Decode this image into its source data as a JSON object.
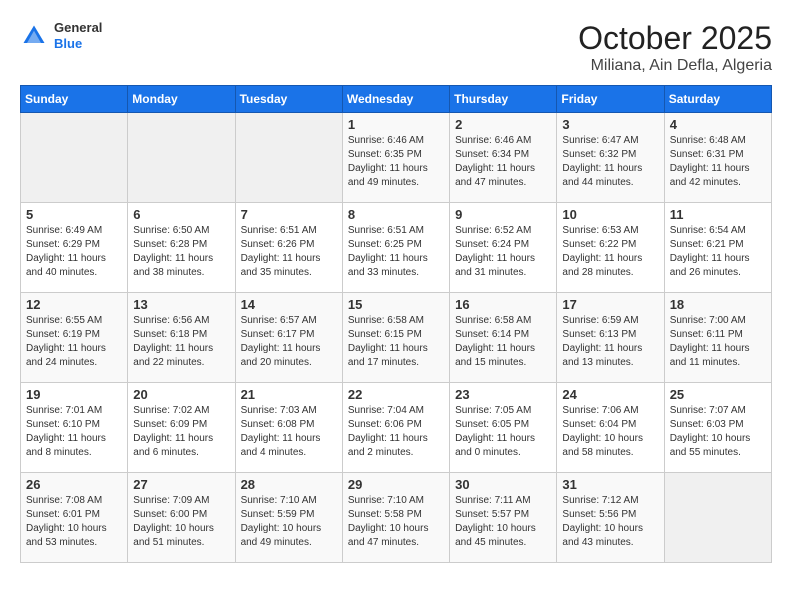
{
  "header": {
    "logo_general": "General",
    "logo_blue": "Blue",
    "title": "October 2025",
    "subtitle": "Miliana, Ain Defla, Algeria"
  },
  "days_of_week": [
    "Sunday",
    "Monday",
    "Tuesday",
    "Wednesday",
    "Thursday",
    "Friday",
    "Saturday"
  ],
  "weeks": [
    [
      {
        "day": "",
        "info": ""
      },
      {
        "day": "",
        "info": ""
      },
      {
        "day": "",
        "info": ""
      },
      {
        "day": "1",
        "info": "Sunrise: 6:46 AM\nSunset: 6:35 PM\nDaylight: 11 hours\nand 49 minutes."
      },
      {
        "day": "2",
        "info": "Sunrise: 6:46 AM\nSunset: 6:34 PM\nDaylight: 11 hours\nand 47 minutes."
      },
      {
        "day": "3",
        "info": "Sunrise: 6:47 AM\nSunset: 6:32 PM\nDaylight: 11 hours\nand 44 minutes."
      },
      {
        "day": "4",
        "info": "Sunrise: 6:48 AM\nSunset: 6:31 PM\nDaylight: 11 hours\nand 42 minutes."
      }
    ],
    [
      {
        "day": "5",
        "info": "Sunrise: 6:49 AM\nSunset: 6:29 PM\nDaylight: 11 hours\nand 40 minutes."
      },
      {
        "day": "6",
        "info": "Sunrise: 6:50 AM\nSunset: 6:28 PM\nDaylight: 11 hours\nand 38 minutes."
      },
      {
        "day": "7",
        "info": "Sunrise: 6:51 AM\nSunset: 6:26 PM\nDaylight: 11 hours\nand 35 minutes."
      },
      {
        "day": "8",
        "info": "Sunrise: 6:51 AM\nSunset: 6:25 PM\nDaylight: 11 hours\nand 33 minutes."
      },
      {
        "day": "9",
        "info": "Sunrise: 6:52 AM\nSunset: 6:24 PM\nDaylight: 11 hours\nand 31 minutes."
      },
      {
        "day": "10",
        "info": "Sunrise: 6:53 AM\nSunset: 6:22 PM\nDaylight: 11 hours\nand 28 minutes."
      },
      {
        "day": "11",
        "info": "Sunrise: 6:54 AM\nSunset: 6:21 PM\nDaylight: 11 hours\nand 26 minutes."
      }
    ],
    [
      {
        "day": "12",
        "info": "Sunrise: 6:55 AM\nSunset: 6:19 PM\nDaylight: 11 hours\nand 24 minutes."
      },
      {
        "day": "13",
        "info": "Sunrise: 6:56 AM\nSunset: 6:18 PM\nDaylight: 11 hours\nand 22 minutes."
      },
      {
        "day": "14",
        "info": "Sunrise: 6:57 AM\nSunset: 6:17 PM\nDaylight: 11 hours\nand 20 minutes."
      },
      {
        "day": "15",
        "info": "Sunrise: 6:58 AM\nSunset: 6:15 PM\nDaylight: 11 hours\nand 17 minutes."
      },
      {
        "day": "16",
        "info": "Sunrise: 6:58 AM\nSunset: 6:14 PM\nDaylight: 11 hours\nand 15 minutes."
      },
      {
        "day": "17",
        "info": "Sunrise: 6:59 AM\nSunset: 6:13 PM\nDaylight: 11 hours\nand 13 minutes."
      },
      {
        "day": "18",
        "info": "Sunrise: 7:00 AM\nSunset: 6:11 PM\nDaylight: 11 hours\nand 11 minutes."
      }
    ],
    [
      {
        "day": "19",
        "info": "Sunrise: 7:01 AM\nSunset: 6:10 PM\nDaylight: 11 hours\nand 8 minutes."
      },
      {
        "day": "20",
        "info": "Sunrise: 7:02 AM\nSunset: 6:09 PM\nDaylight: 11 hours\nand 6 minutes."
      },
      {
        "day": "21",
        "info": "Sunrise: 7:03 AM\nSunset: 6:08 PM\nDaylight: 11 hours\nand 4 minutes."
      },
      {
        "day": "22",
        "info": "Sunrise: 7:04 AM\nSunset: 6:06 PM\nDaylight: 11 hours\nand 2 minutes."
      },
      {
        "day": "23",
        "info": "Sunrise: 7:05 AM\nSunset: 6:05 PM\nDaylight: 11 hours\nand 0 minutes."
      },
      {
        "day": "24",
        "info": "Sunrise: 7:06 AM\nSunset: 6:04 PM\nDaylight: 10 hours\nand 58 minutes."
      },
      {
        "day": "25",
        "info": "Sunrise: 7:07 AM\nSunset: 6:03 PM\nDaylight: 10 hours\nand 55 minutes."
      }
    ],
    [
      {
        "day": "26",
        "info": "Sunrise: 7:08 AM\nSunset: 6:01 PM\nDaylight: 10 hours\nand 53 minutes."
      },
      {
        "day": "27",
        "info": "Sunrise: 7:09 AM\nSunset: 6:00 PM\nDaylight: 10 hours\nand 51 minutes."
      },
      {
        "day": "28",
        "info": "Sunrise: 7:10 AM\nSunset: 5:59 PM\nDaylight: 10 hours\nand 49 minutes."
      },
      {
        "day": "29",
        "info": "Sunrise: 7:10 AM\nSunset: 5:58 PM\nDaylight: 10 hours\nand 47 minutes."
      },
      {
        "day": "30",
        "info": "Sunrise: 7:11 AM\nSunset: 5:57 PM\nDaylight: 10 hours\nand 45 minutes."
      },
      {
        "day": "31",
        "info": "Sunrise: 7:12 AM\nSunset: 5:56 PM\nDaylight: 10 hours\nand 43 minutes."
      },
      {
        "day": "",
        "info": ""
      }
    ]
  ]
}
